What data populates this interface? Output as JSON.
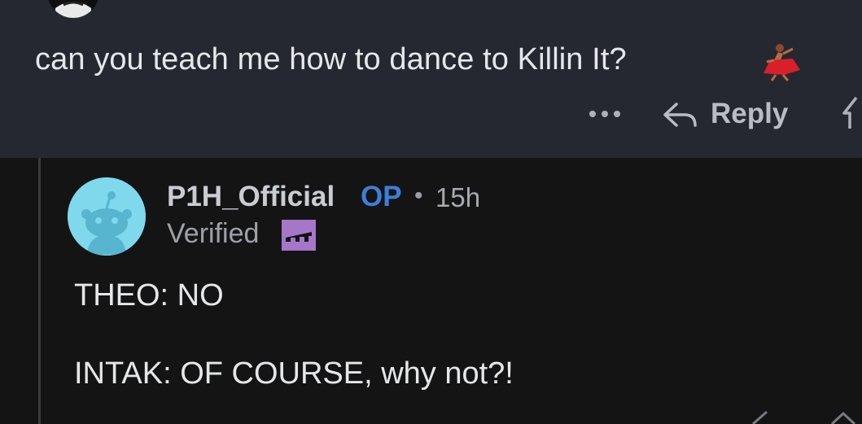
{
  "parent_comment": {
    "text": "can you teach me how to dance to Killin It?",
    "emoji": "💃",
    "actions": {
      "more_label": "…",
      "reply_label": "Reply"
    }
  },
  "reply_comment": {
    "username": "P1H_Official",
    "op_label": "OP",
    "separator": "•",
    "timestamp": "15h",
    "status": "Verified",
    "body": [
      "THEO: NO",
      "INTAK: OF COURSE, why not?!"
    ]
  },
  "colors": {
    "parent_bg": "#252830",
    "page_bg": "#141415",
    "op_blue": "#3d7fd8",
    "avatar_bg": "#7fd8ec",
    "flair_purple": "#a676c8"
  },
  "icons": {
    "more": "more-dots-icon",
    "reply": "reply-arrow-icon",
    "upvote": "upvote-arrow-icon",
    "dancer": "dancer-emoji-icon",
    "avatar": "reddit-snoo-avatar-icon",
    "flair": "flair-badge-icon"
  }
}
